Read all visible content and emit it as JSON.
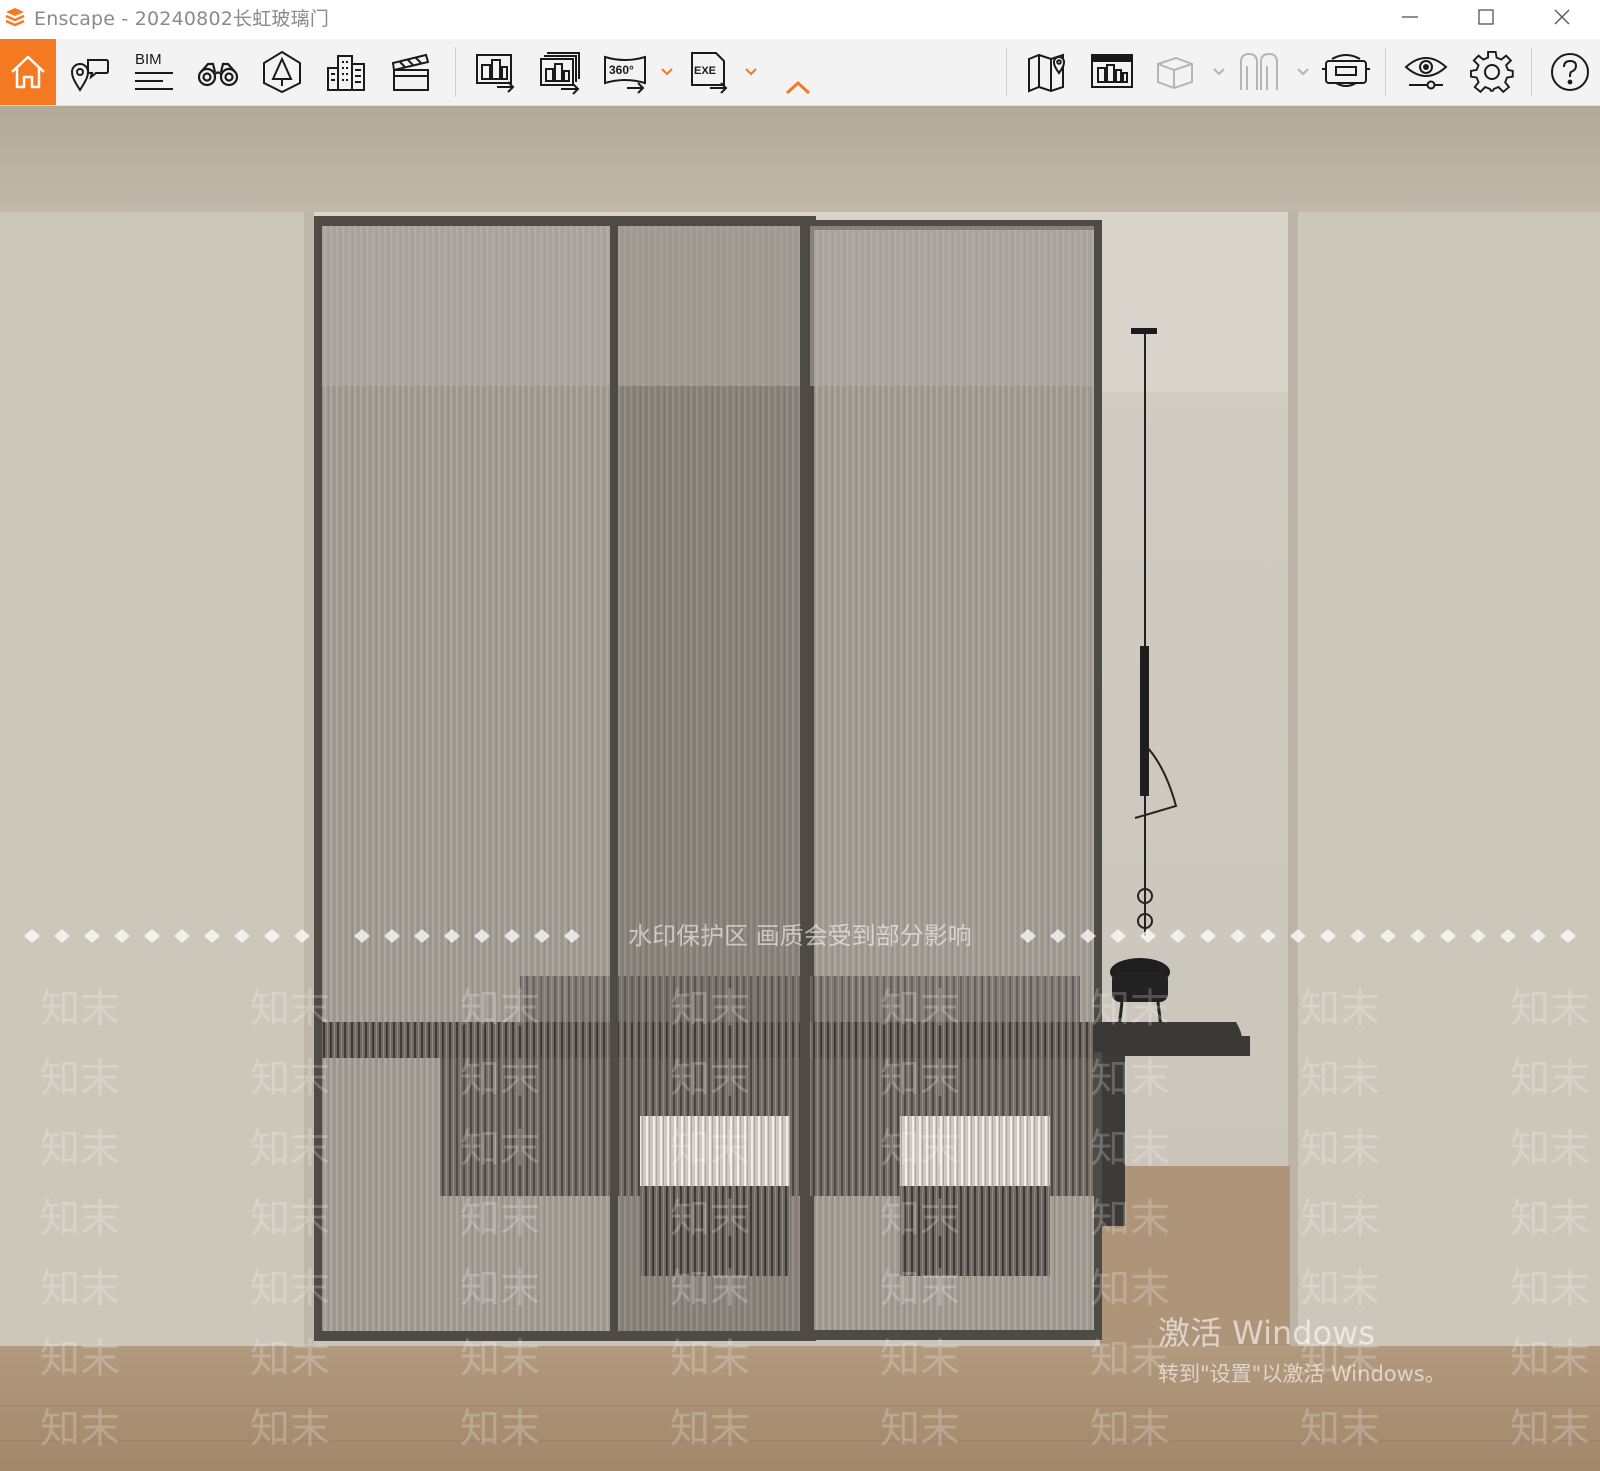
{
  "window": {
    "title": "Enscape - 20240802长虹玻璃门",
    "controls": [
      "minimize-icon",
      "maximize-icon",
      "close-icon"
    ]
  },
  "toolbar": {
    "accent_color": "#f47920",
    "bim_label": "BIM",
    "panorama_label": "360°",
    "exe_label": "EXE",
    "buttons": [
      {
        "name": "home",
        "icon": "home-icon",
        "active": true
      },
      {
        "name": "views",
        "icon": "pin-speech-icon"
      },
      {
        "name": "bim",
        "icon": "bim-info-icon"
      },
      {
        "name": "walk-mode",
        "icon": "binoculars-icon"
      },
      {
        "name": "asset-library",
        "icon": "tree-icon"
      },
      {
        "name": "material-editor",
        "icon": "buildings-icon"
      },
      {
        "name": "video-editor",
        "icon": "clapperboard-icon"
      },
      {
        "name": "render-image",
        "icon": "render-image-icon"
      },
      {
        "name": "batch-render",
        "icon": "batch-render-icon"
      },
      {
        "name": "render-panorama",
        "icon": "panorama-360-icon"
      },
      {
        "name": "export-exe",
        "icon": "export-exe-icon"
      },
      {
        "name": "collapse-toolbar",
        "icon": "chevron-up-icon"
      },
      {
        "name": "map",
        "icon": "map-icon"
      },
      {
        "name": "view-management",
        "icon": "view-management-icon"
      },
      {
        "name": "cube-view",
        "icon": "cube-icon"
      },
      {
        "name": "section-view",
        "icon": "section-icon"
      },
      {
        "name": "vr-headset",
        "icon": "vr-headset-icon"
      },
      {
        "name": "visual-settings",
        "icon": "eye-icon"
      },
      {
        "name": "general-settings",
        "icon": "gear-icon"
      },
      {
        "name": "help",
        "icon": "help-icon"
      }
    ]
  },
  "viewport": {
    "watermark_banner": "水印保护区   画质会受到部分影响",
    "watermark_text": "知末",
    "activation_title": "激活 Windows",
    "activation_subtitle": "转到\"设置\"以激活 Windows。",
    "colors": {
      "wall": "#cdc6ba",
      "ceiling": "#b8ae9f",
      "floor": "#a68b6f",
      "glass": "#9c968e",
      "frame": "#4e4a46"
    }
  }
}
